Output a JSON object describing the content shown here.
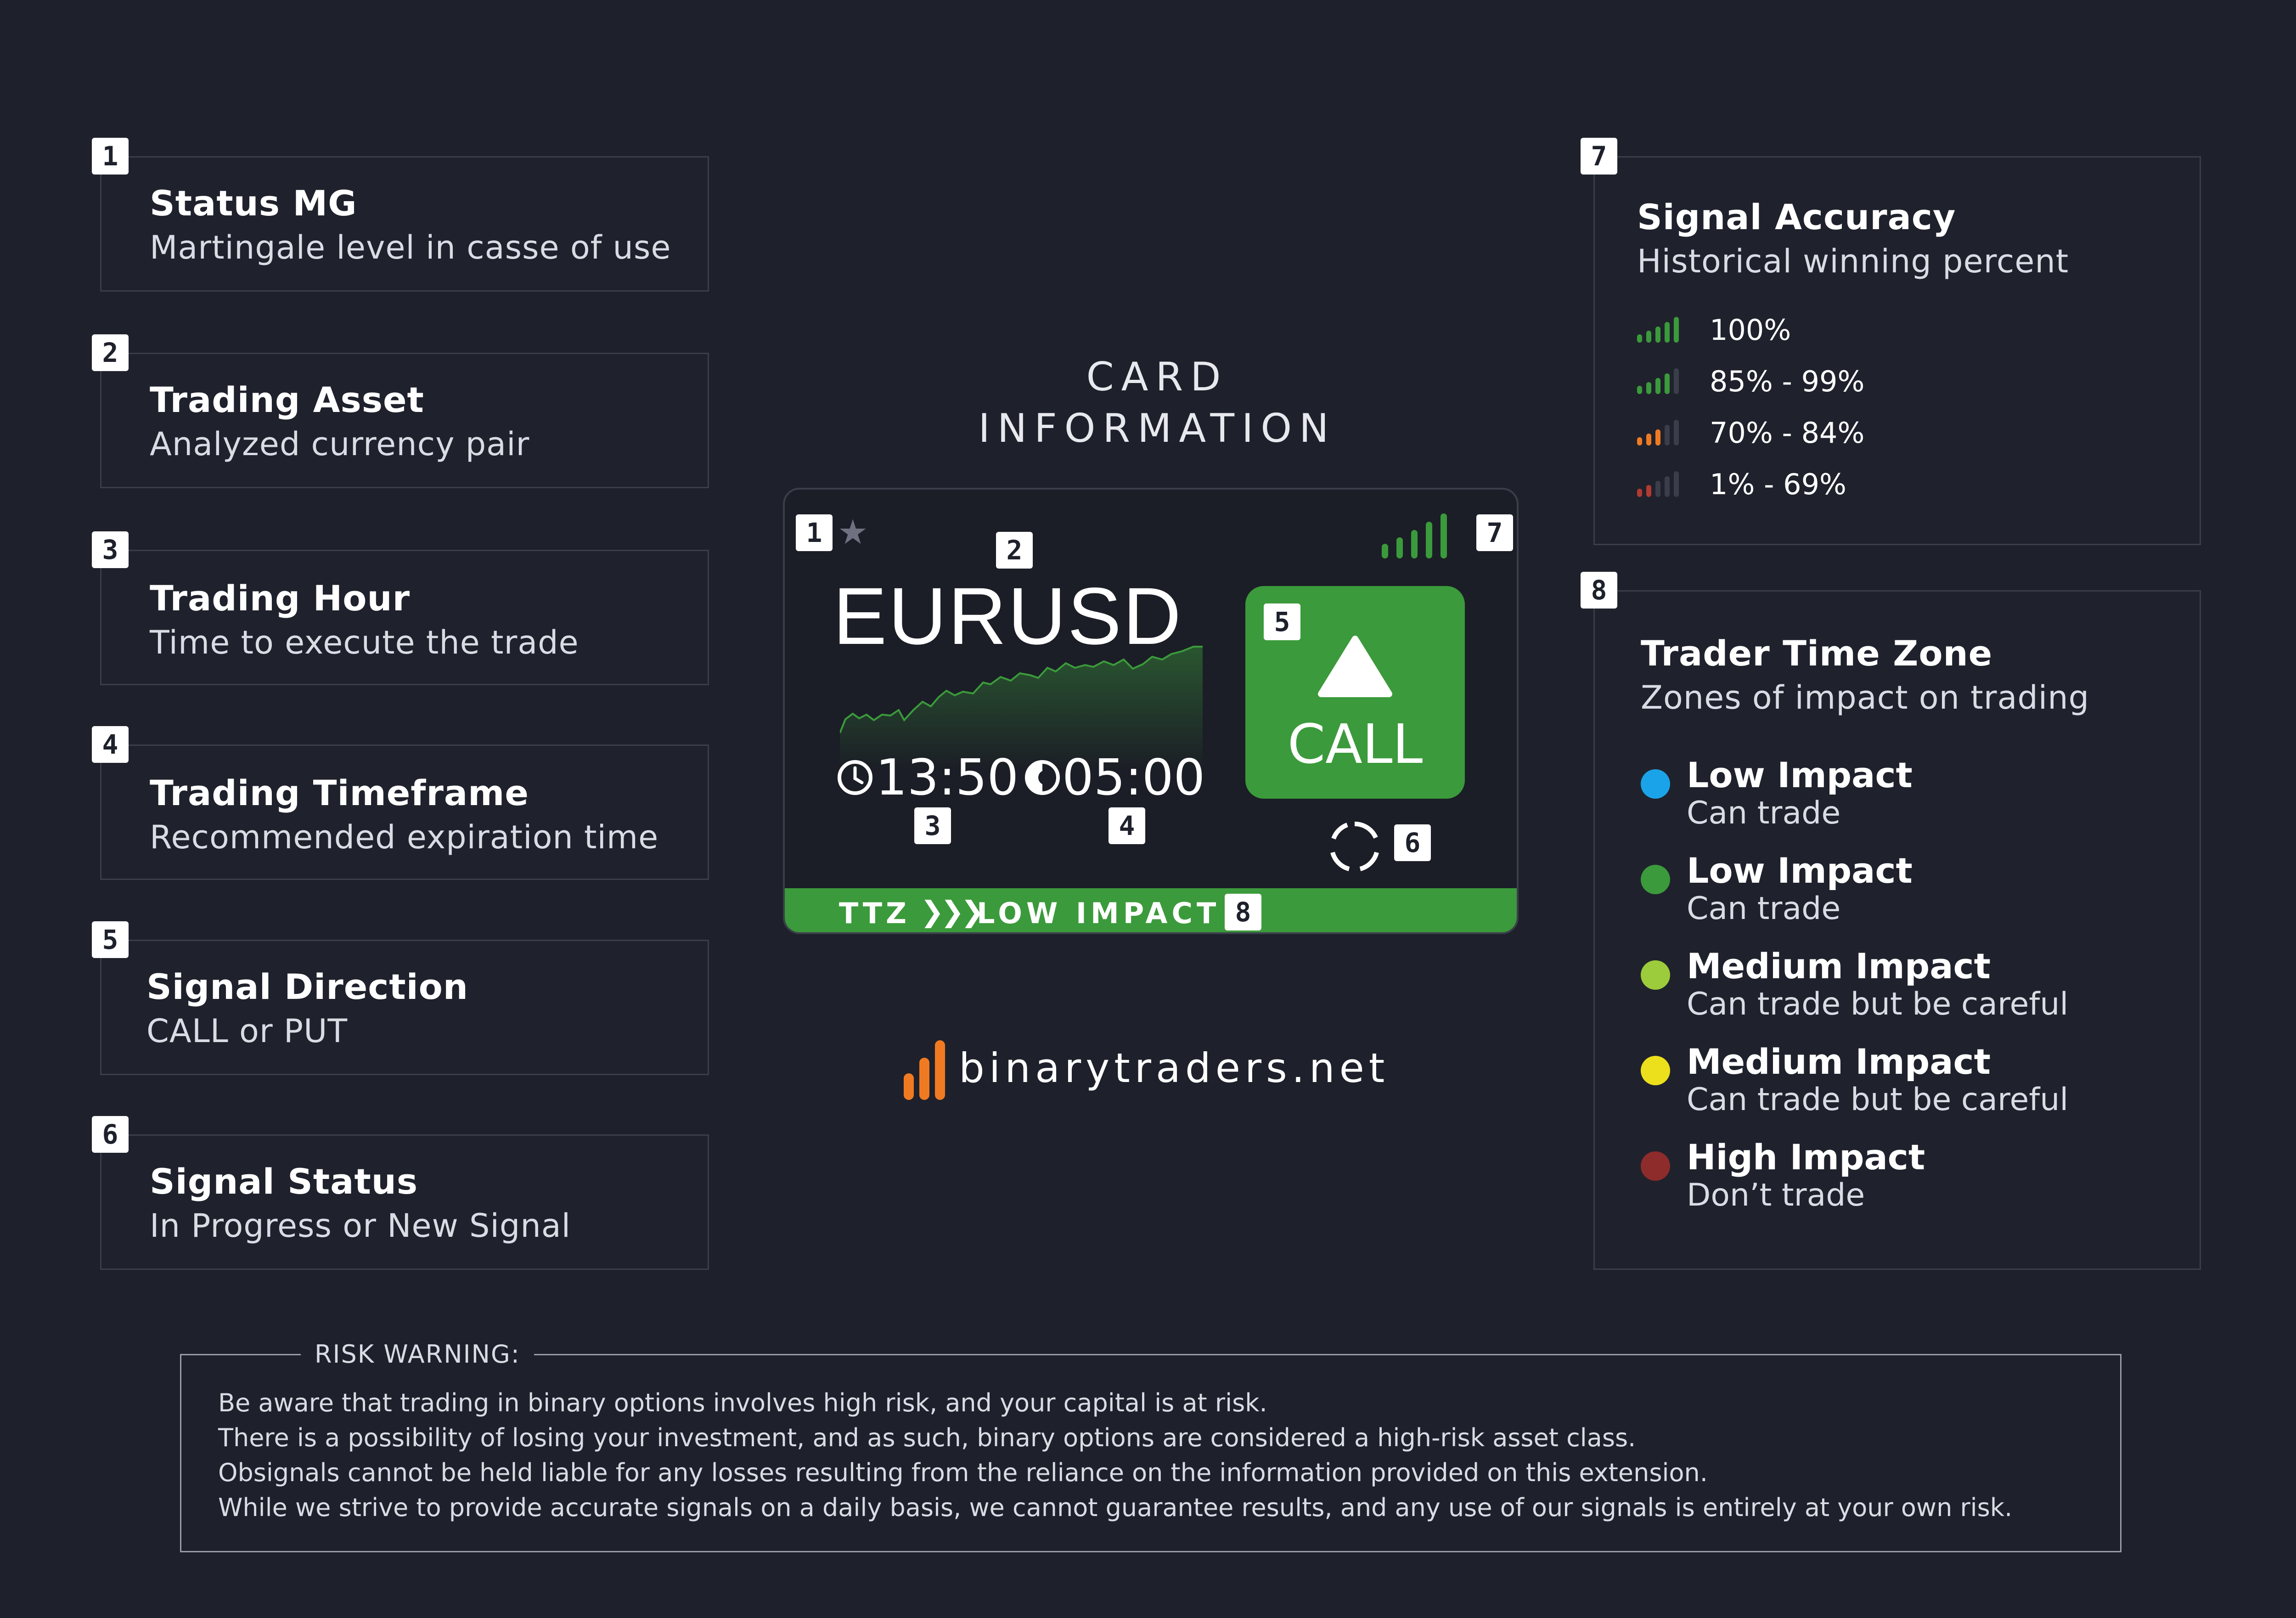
{
  "left_cards": [
    {
      "num": "1",
      "title": "Status MG",
      "desc": "Martingale level in casse of use"
    },
    {
      "num": "2",
      "title": "Trading Asset",
      "desc": "Analyzed currency pair"
    },
    {
      "num": "3",
      "title": "Trading Hour",
      "desc": "Time to execute the trade"
    },
    {
      "num": "4",
      "title": "Trading Timeframe",
      "desc": "Recommended expiration time"
    },
    {
      "num": "5",
      "title": "Signal Direction",
      "desc": "CALL or PUT"
    },
    {
      "num": "6",
      "title": "Signal Status",
      "desc": "In Progress or New Signal"
    }
  ],
  "center": {
    "heading_line1": "CARD",
    "heading_line2": "INFORMATION",
    "card": {
      "asset": "EURUSD",
      "trade_time": "13:50",
      "timeframe": "05:00",
      "direction": "CALL",
      "ttz_label": "TTZ",
      "ttz_arrows": "❯❯❯",
      "ttz_value": "LOW IMPACT",
      "badges": {
        "mg": "1",
        "asset": "2",
        "time": "3",
        "timeframe": "4",
        "direction": "5",
        "status": "6",
        "accuracy": "7",
        "ttz": "8"
      }
    },
    "brand": "binarytraders.net"
  },
  "accuracy": {
    "num": "7",
    "title": "Signal Accuracy",
    "desc": "Historical winning percent",
    "levels": [
      {
        "label": "100%",
        "active_bars": 5,
        "color": "#3b9a3b"
      },
      {
        "label": "85% - 99%",
        "active_bars": 4,
        "color": "#3b9a3b"
      },
      {
        "label": "70% - 84%",
        "active_bars": 3,
        "color": "#f07a22"
      },
      {
        "label": "1% - 69%",
        "active_bars": 2,
        "color": "#b23a32"
      }
    ]
  },
  "time_zone": {
    "num": "8",
    "title": "Trader Time Zone",
    "desc": "Zones of impact on trading",
    "zones": [
      {
        "title": "Low Impact",
        "desc": "Can trade",
        "color": "#1aa3e8"
      },
      {
        "title": "Low Impact",
        "desc": "Can trade",
        "color": "#3b9a3b"
      },
      {
        "title": "Medium Impact",
        "desc": "Can trade but be careful",
        "color": "#9ccb3b"
      },
      {
        "title": "Medium Impact",
        "desc": "Can trade but be careful",
        "color": "#ecdf1c"
      },
      {
        "title": "High Impact",
        "desc": "Don’t trade",
        "color": "#8e2b2b"
      }
    ]
  },
  "risk_warning": {
    "title": "RISK WARNING:",
    "lines": [
      "Be aware that trading in binary options involves high risk, and your capital is at risk.",
      "There is a possibility of losing your investment, and as such, binary options are considered a high-risk asset class.",
      "Obsignals cannot be held liable for any losses resulting from the reliance on the information provided on this extension.",
      "While we strive to provide accurate signals on a daily basis, we cannot guarantee results, and any use of our signals is entirely at your own risk."
    ]
  },
  "colors": {
    "background": "#1e212b",
    "green": "#3b9a3b",
    "orange": "#f07a22",
    "panel_border": "#3a3e4a"
  }
}
